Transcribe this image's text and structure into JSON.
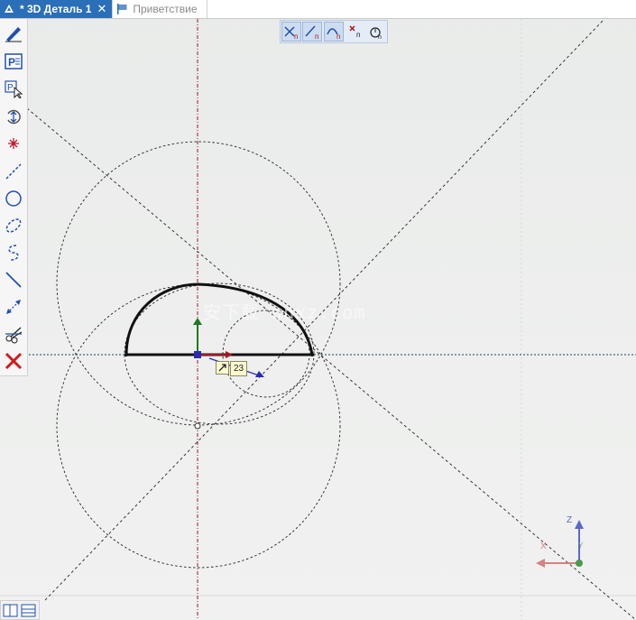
{
  "tabs": [
    {
      "label": "* 3D Деталь 1",
      "close": "✕",
      "active": true
    },
    {
      "label": "Приветствие",
      "active": false
    }
  ],
  "snap_buttons": [
    {
      "icon": "snap-intersection-icon",
      "on": true
    },
    {
      "icon": "snap-endpoint-icon",
      "on": true
    },
    {
      "icon": "snap-tangent-icon",
      "on": true
    },
    {
      "icon": "snap-point-icon",
      "on": false
    },
    {
      "icon": "snap-settings-icon",
      "on": false
    }
  ],
  "left_tools": [
    "sketch-pen-icon",
    "text-frame-icon",
    "text-cursor-icon",
    "rotate-view-icon",
    "point-icon",
    "line-icon",
    "circle-icon",
    "ellipse-icon",
    "arc-icon",
    "diagonal-line-icon",
    "dimension-icon",
    "trim-icon",
    "delete-icon"
  ],
  "dimension": {
    "value": "23"
  },
  "watermark": "安下载 anxz.com",
  "axes": {
    "x": "X",
    "y": "Y",
    "z": "Z"
  },
  "colors": {
    "accent": "#2a6fb8",
    "axis_red": "#a8141e",
    "axis_green": "#1d7a1d",
    "axis_blue": "#2a2ab0"
  }
}
